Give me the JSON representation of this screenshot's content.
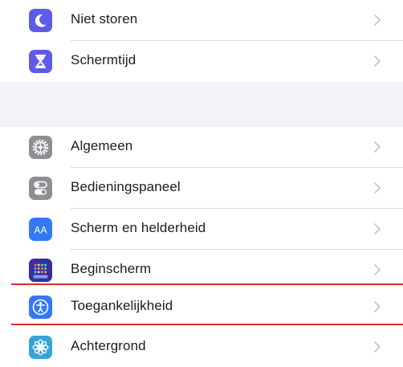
{
  "settings": {
    "rows": [
      {
        "id": "niet-storen",
        "label": "Niet storen",
        "icon": "moon-icon",
        "icon_color": "#5e5ce6"
      },
      {
        "id": "schermtijd",
        "label": "Schermtijd",
        "icon": "hourglass-icon",
        "icon_color": "#5e5ce6"
      },
      {
        "id": "algemeen",
        "label": "Algemeen",
        "icon": "gear-icon",
        "icon_color": "#8e8e93"
      },
      {
        "id": "bedieningspaneel",
        "label": "Bedieningspaneel",
        "icon": "toggle-switches-icon",
        "icon_color": "#8e8e93"
      },
      {
        "id": "scherm-en-helderheid",
        "label": "Scherm en helderheid",
        "icon": "text-size-icon",
        "icon_color": "#3478f6"
      },
      {
        "id": "beginscherm",
        "label": "Beginscherm",
        "icon": "app-grid-icon",
        "icon_color": "#3a3aa8"
      },
      {
        "id": "toegankelijkheid",
        "label": "Toegankelijkheid",
        "icon": "accessibility-icon",
        "icon_color": "#3478f6"
      },
      {
        "id": "achtergrond",
        "label": "Achtergrond",
        "icon": "flower-icon",
        "icon_color": "#34a4d9"
      }
    ],
    "icon_text": {
      "text_size": "AA"
    }
  },
  "colors": {
    "highlight": "#d32f2f",
    "chevron": "#c4c4c7",
    "separator": "#d8d8dc",
    "group_gap": "#f2f2f7"
  }
}
